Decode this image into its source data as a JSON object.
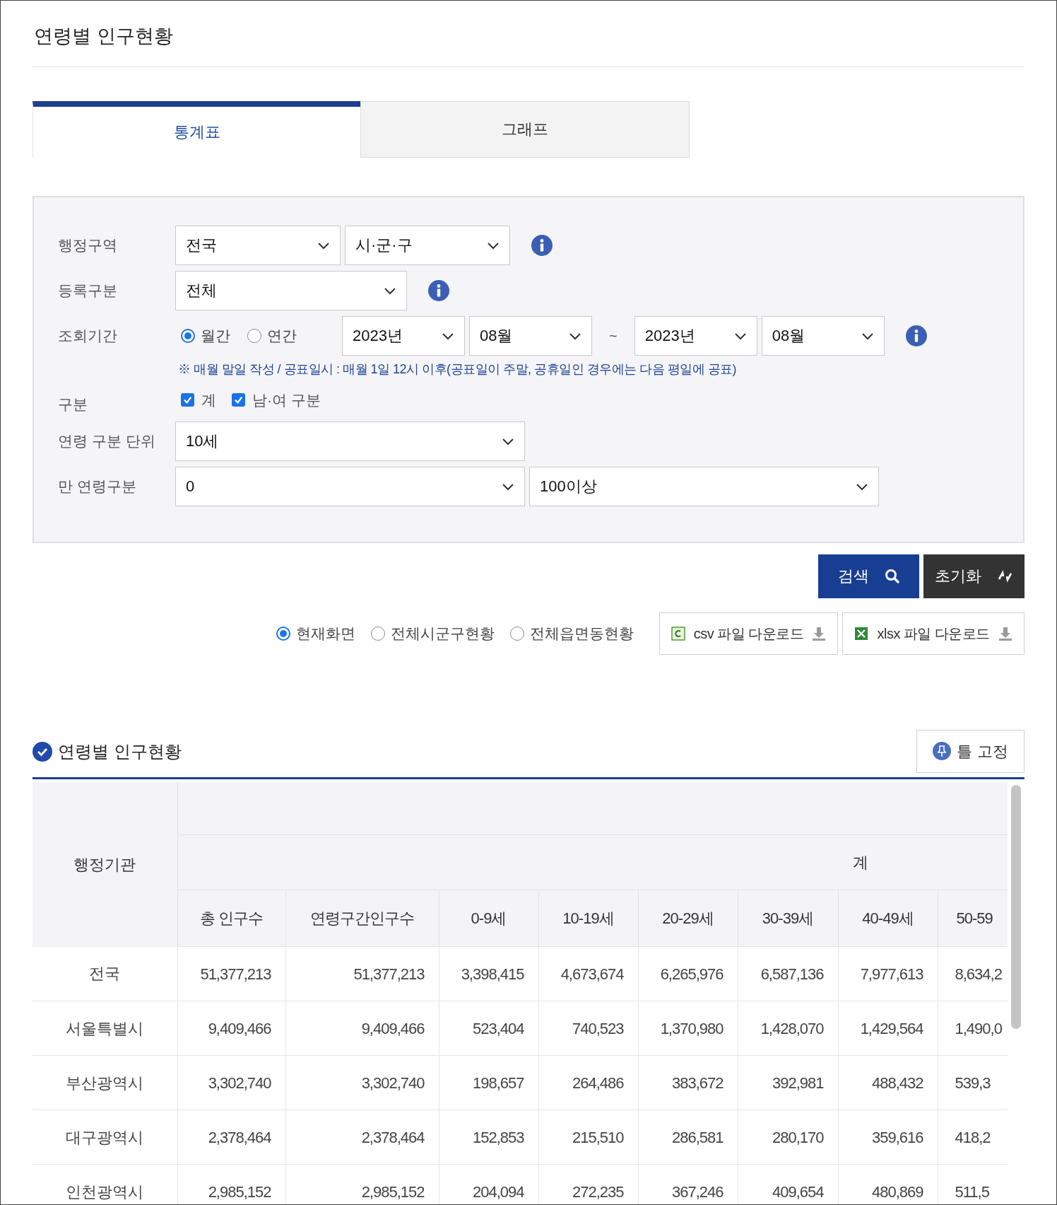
{
  "page_title": "연령별 인구현황",
  "tabs": [
    {
      "label": "통계표",
      "selected": true
    },
    {
      "label": "그래프",
      "selected": false
    }
  ],
  "filters": [
    {
      "label": "행정구역",
      "kind": "selects",
      "selects": [
        "전국",
        "시·군·구"
      ],
      "info": true
    },
    {
      "label": "등록구분",
      "kind": "selects",
      "selects": [
        "전체"
      ],
      "info": true
    },
    {
      "label": "조회기간",
      "kind": "period",
      "radios": [
        {
          "label": "월간",
          "selected": true
        },
        {
          "label": "연간",
          "selected": false
        }
      ],
      "from": [
        "2023년",
        "08월"
      ],
      "separator": "~",
      "to": [
        "2023년",
        "08월"
      ],
      "info": true,
      "note": "※ 매월 말일 작성 / 공표일시 : 매월 1일 12시 이후(공표일이 주말, 공휴일인 경우에는 다음 평일에 공표)"
    },
    {
      "label": "구분",
      "kind": "checks",
      "checks": [
        {
          "label": "계",
          "checked": true
        },
        {
          "label": "남·여 구분",
          "checked": true
        }
      ],
      "info": false
    },
    {
      "label": "연령 구분 단위",
      "kind": "selects",
      "selects": [
        "10세"
      ],
      "info": false
    },
    {
      "label": "만 연령구분",
      "kind": "selects",
      "selects": [
        "0",
        "100이상"
      ],
      "info": false
    }
  ],
  "actions": [
    {
      "label": "검색",
      "kind": "search"
    },
    {
      "label": "초기화",
      "kind": "reset"
    }
  ],
  "scope": [
    {
      "label": "현재화면",
      "selected": true
    },
    {
      "label": "전체시군구현황",
      "selected": false
    },
    {
      "label": "전체읍면동현황",
      "selected": false
    }
  ],
  "downloads": [
    {
      "label": "csv 파일 다운로드",
      "kind": "csv"
    },
    {
      "label": "xlsx 파일 다운로드",
      "kind": "xlsx"
    }
  ],
  "section": {
    "title": "연령별 인구현황",
    "freeze_button": "틀 고정"
  },
  "table": {
    "corner": "행정기관",
    "group_header": "계",
    "columns": [
      "총 인구수",
      "연령구간인구수",
      "0-9세",
      "10-19세",
      "20-29세",
      "30-39세",
      "40-49세",
      "50-59"
    ],
    "rows": [
      {
        "name": "전국",
        "values": [
          "51,377,213",
          "51,377,213",
          "3,398,415",
          "4,673,674",
          "6,265,976",
          "6,587,136",
          "7,977,613",
          "8,634,2"
        ]
      },
      {
        "name": "서울특별시",
        "values": [
          "9,409,466",
          "9,409,466",
          "523,404",
          "740,523",
          "1,370,980",
          "1,428,070",
          "1,429,564",
          "1,490,0"
        ]
      },
      {
        "name": "부산광역시",
        "values": [
          "3,302,740",
          "3,302,740",
          "198,657",
          "264,486",
          "383,672",
          "392,981",
          "488,432",
          "539,3"
        ]
      },
      {
        "name": "대구광역시",
        "values": [
          "2,378,464",
          "2,378,464",
          "152,853",
          "215,510",
          "286,581",
          "280,170",
          "359,616",
          "418,2"
        ]
      },
      {
        "name": "인천광역시",
        "values": [
          "2,985,152",
          "2,985,152",
          "204,094",
          "272,235",
          "367,246",
          "409,654",
          "480,869",
          "511,5"
        ]
      }
    ]
  }
}
